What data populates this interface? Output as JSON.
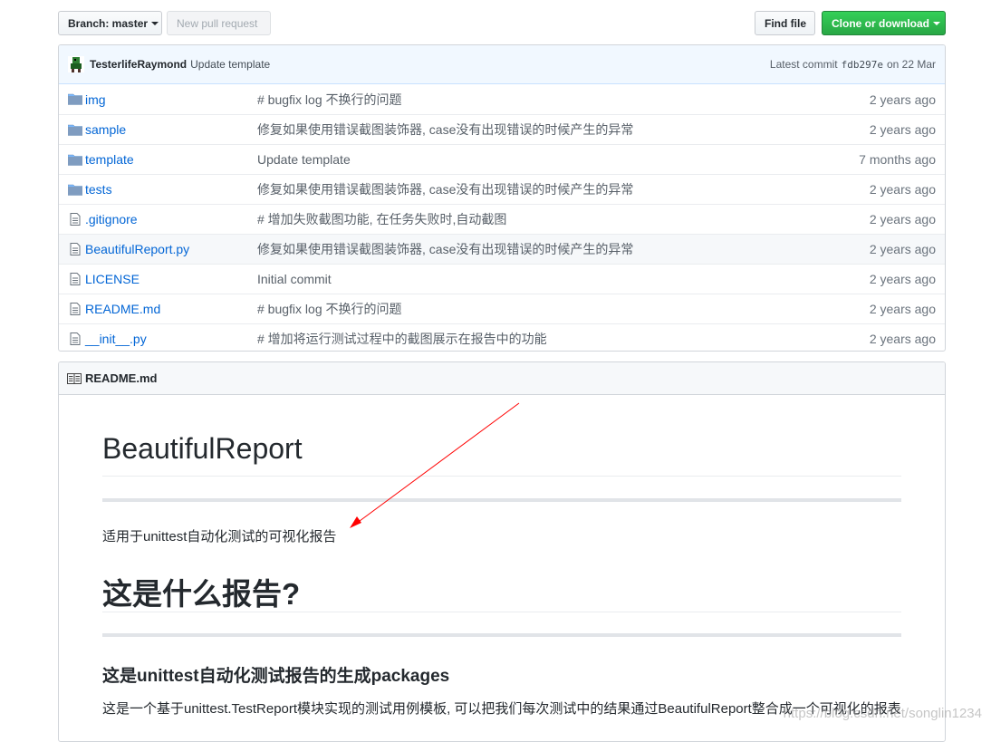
{
  "toolbar": {
    "branch_label": "Branch: master",
    "new_pr_label": "New pull request",
    "find_file_label": "Find file",
    "clone_label": "Clone or download"
  },
  "commit": {
    "author": "TesterlifeRaymond",
    "message": "Update template",
    "latest_prefix": "Latest commit",
    "sha": "fdb297e",
    "date": "on 22 Mar"
  },
  "files": [
    {
      "name": "img",
      "type": "folder",
      "message": "# bugfix log 不换行的问题",
      "age": "2 years ago"
    },
    {
      "name": "sample",
      "type": "folder",
      "message": "修复如果使用错误截图装饰器, case没有出现错误的时候产生的异常",
      "age": "2 years ago"
    },
    {
      "name": "template",
      "type": "folder",
      "message": "Update template",
      "age": "7 months ago"
    },
    {
      "name": "tests",
      "type": "folder",
      "message": "修复如果使用错误截图装饰器, case没有出现错误的时候产生的异常",
      "age": "2 years ago"
    },
    {
      "name": ".gitignore",
      "type": "file",
      "message": "# 增加失败截图功能, 在任务失败时,自动截图",
      "age": "2 years ago"
    },
    {
      "name": "BeautifulReport.py",
      "type": "file",
      "message": "修复如果使用错误截图装饰器, case没有出现错误的时候产生的异常",
      "age": "2 years ago"
    },
    {
      "name": "LICENSE",
      "type": "file",
      "message": "Initial commit",
      "age": "2 years ago"
    },
    {
      "name": "README.md",
      "type": "file",
      "message": "# bugfix log 不换行的问题",
      "age": "2 years ago"
    },
    {
      "name": "__init__.py",
      "type": "file",
      "message": "# 增加将运行测试过程中的截图展示在报告中的功能",
      "age": "2 years ago"
    }
  ],
  "readme": {
    "filename": "README.md",
    "h1": "BeautifulReport",
    "intro": "适用于unittest自动化测试的可视化报告",
    "h1_2": "这是什么报告?",
    "h3": "这是unittest自动化测试报告的生成packages",
    "body": "这是一个基于unittest.TestReport模块实现的测试用例模板, 可以把我们每次测试中的结果通过BeautifulReport整合成一个可视化的报表"
  },
  "watermark": "https://blog.csdn.net/songlin1234",
  "colors": {
    "link": "#0366d6",
    "green": "#28a745",
    "arrow": "#ff0000"
  }
}
